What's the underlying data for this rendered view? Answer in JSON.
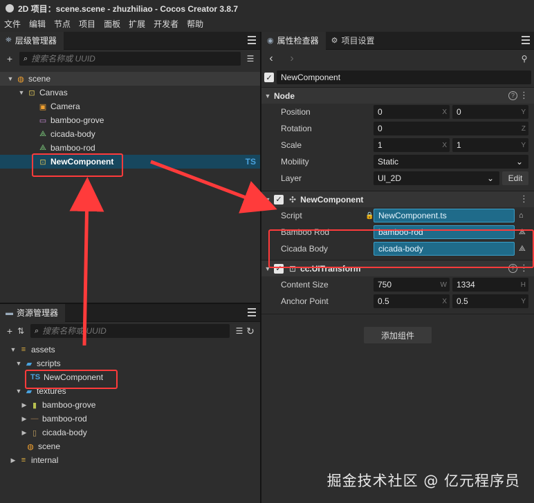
{
  "title": "2D 项目：scene.scene - zhuzhiliao - Cocos Creator 3.8.7",
  "menu": [
    "文件",
    "编辑",
    "节点",
    "项目",
    "面板",
    "扩展",
    "开发者",
    "帮助"
  ],
  "hierarchy": {
    "tab": "层级管理器",
    "search_placeholder": "搜索名称或 UUID",
    "items": [
      {
        "label": "scene"
      },
      {
        "label": "Canvas"
      },
      {
        "label": "Camera"
      },
      {
        "label": "bamboo-grove"
      },
      {
        "label": "cicada-body"
      },
      {
        "label": "bamboo-rod"
      },
      {
        "label": "NewComponent",
        "tag": "TS"
      }
    ]
  },
  "assets": {
    "tab": "资源管理器",
    "search_placeholder": "搜索名称或 UUID",
    "items": [
      {
        "label": "assets"
      },
      {
        "label": "scripts"
      },
      {
        "label": "NewComponent",
        "tag": "TS"
      },
      {
        "label": "textures"
      },
      {
        "label": "bamboo-grove"
      },
      {
        "label": "bamboo-rod"
      },
      {
        "label": "cicada-body"
      },
      {
        "label": "scene"
      },
      {
        "label": "internal"
      }
    ]
  },
  "inspector": {
    "tabs": [
      "属性检查器",
      "项目设置"
    ],
    "node_name": "NewComponent",
    "node_section": "Node",
    "position": {
      "label": "Position",
      "x": "0",
      "y": "0"
    },
    "rotation": {
      "label": "Rotation",
      "z": "0"
    },
    "scale": {
      "label": "Scale",
      "x": "1",
      "y": "1"
    },
    "mobility": {
      "label": "Mobility",
      "value": "Static"
    },
    "layer": {
      "label": "Layer",
      "value": "UI_2D",
      "edit": "Edit"
    },
    "component": {
      "title": "NewComponent",
      "script_label": "Script",
      "script_value": "NewComponent.ts",
      "bamboo_label": "Bamboo Rod",
      "bamboo_value": "bamboo-rod",
      "cicada_label": "Cicada Body",
      "cicada_value": "cicada-body"
    },
    "uitransform": {
      "title": "cc.UITransform",
      "content_label": "Content Size",
      "w": "750",
      "h": "1334",
      "anchor_label": "Anchor Point",
      "ax": "0.5",
      "ay": "0.5"
    },
    "add_component": "添加组件"
  },
  "axis": {
    "x": "X",
    "y": "Y",
    "z": "Z",
    "w": "W",
    "h": "H"
  },
  "watermark": "掘金技术社区 @ 亿元程序员",
  "colors": {
    "selection": "#17475e",
    "highlight": "#ff3b3b",
    "ts": "#4aa3df",
    "blue_field": "#1f6b8a"
  }
}
